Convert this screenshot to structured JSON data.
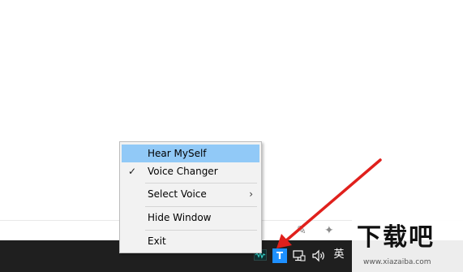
{
  "context_menu": {
    "items": [
      {
        "label": "Hear MySelf",
        "checked": false,
        "highlighted": true,
        "has_submenu": false
      },
      {
        "label": "Voice Changer",
        "checked": true,
        "highlighted": false,
        "has_submenu": false
      },
      {
        "label": "Select Voice",
        "checked": false,
        "highlighted": false,
        "has_submenu": true
      },
      {
        "label": "Hide Window",
        "checked": false,
        "highlighted": false,
        "has_submenu": false
      },
      {
        "label": "Exit",
        "checked": false,
        "highlighted": false,
        "has_submenu": false
      }
    ],
    "check_glyph": "✓",
    "submenu_glyph": "›",
    "highlight_color": "#91c9f7"
  },
  "tray": {
    "chevron_glyph": "^",
    "t_icon_letter": "T",
    "ime_text": "英",
    "icons": [
      "show-hidden-icons-chevron",
      "voice-changer-tray-icon",
      "t-app-icon",
      "network-icon",
      "volume-icon",
      "ime-indicator"
    ]
  },
  "watermark": {
    "brand": "下载吧",
    "url": "www.xiazaiba.com"
  },
  "annotation": {
    "arrow_color": "#e0201c"
  }
}
